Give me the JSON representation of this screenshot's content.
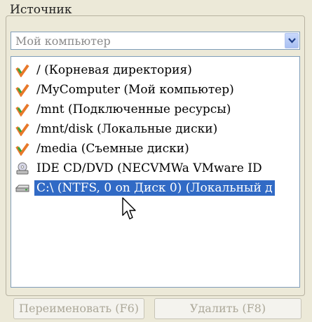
{
  "group_title": "Источник",
  "combo": {
    "value": "Мой компьютер"
  },
  "items": [
    {
      "label": "/ (Корневая директория)",
      "icon": "folder-check-icon",
      "selected": false
    },
    {
      "label": "/MyComputer (Мой компьютер)",
      "icon": "folder-check-icon",
      "selected": false
    },
    {
      "label": "/mnt (Подключенные ресурсы)",
      "icon": "folder-check-icon",
      "selected": false
    },
    {
      "label": "/mnt/disk (Локальные диски)",
      "icon": "folder-check-icon",
      "selected": false
    },
    {
      "label": "/media (Съемные диски)",
      "icon": "folder-check-icon",
      "selected": false
    },
    {
      "label": "IDE CD/DVD (NECVMWa VMware ID",
      "icon": "cd-drive-icon",
      "selected": false
    },
    {
      "label": "C:\\  (NTFS, 0 on Диск 0) (Локальный д",
      "icon": "hard-drive-icon",
      "selected": true
    }
  ],
  "buttons": {
    "rename": "Переименовать (F6)",
    "delete": "Удалить (F8)"
  },
  "colors": {
    "selection": "#316ac5",
    "window_bg": "#ece9d8"
  }
}
